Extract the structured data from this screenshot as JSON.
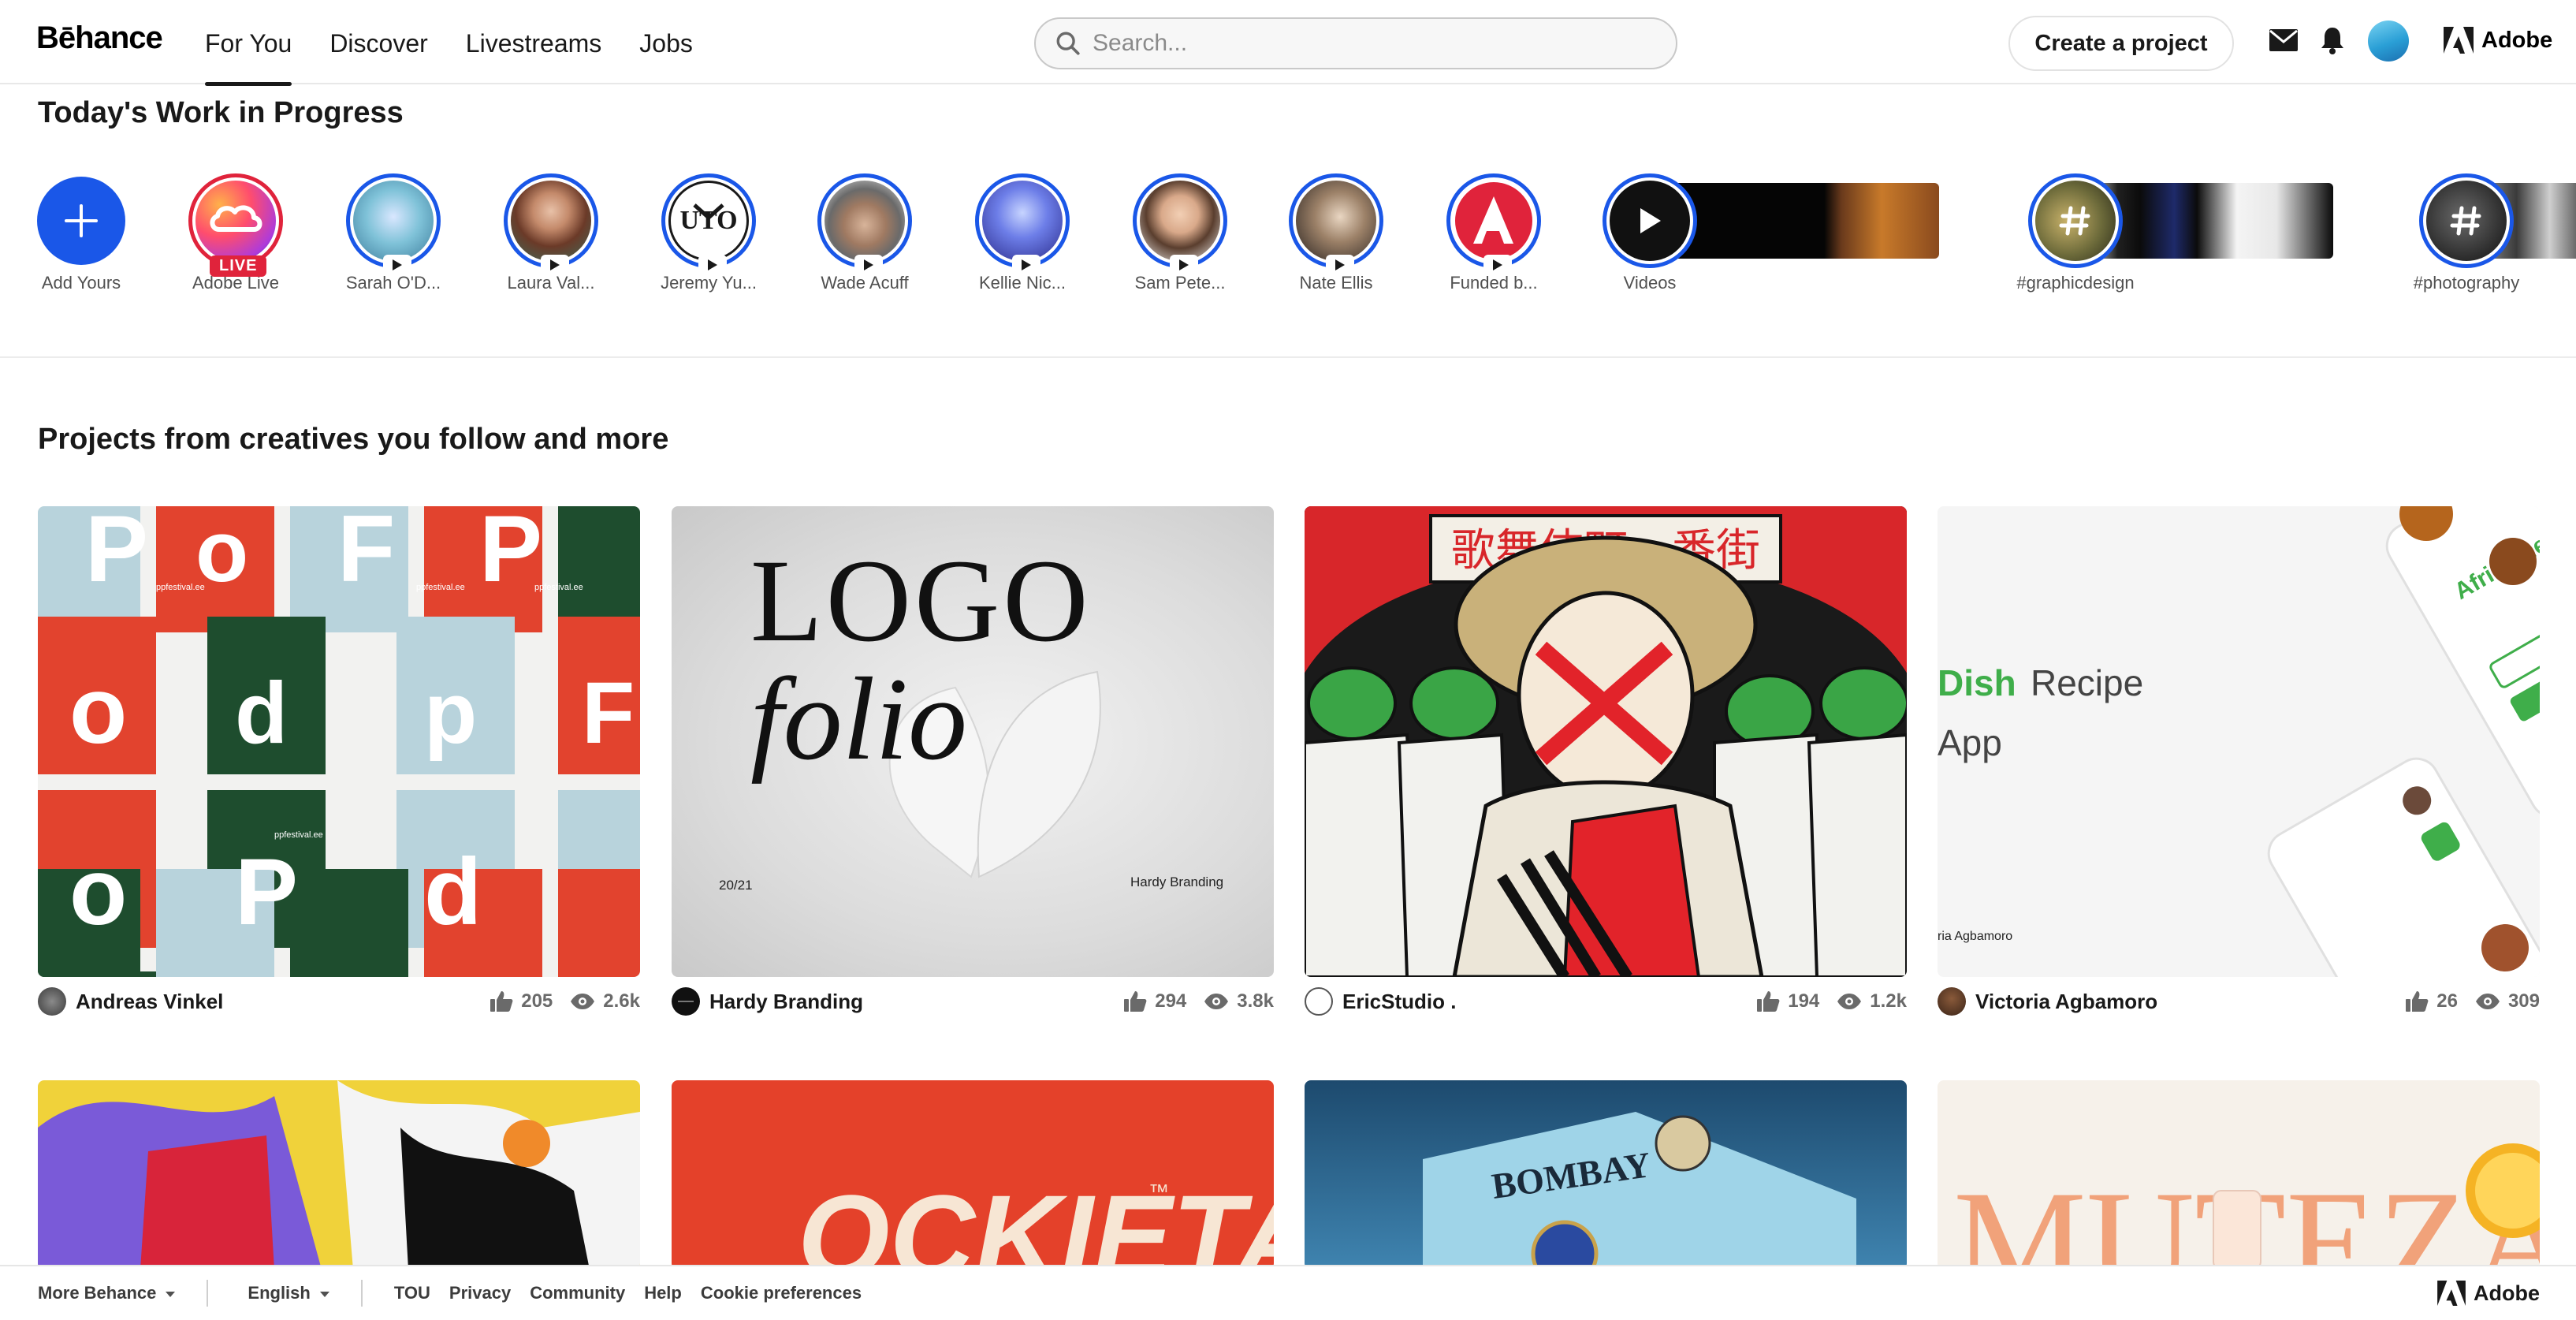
{
  "header": {
    "logo": "Bēhance",
    "nav": [
      "For You",
      "Discover",
      "Livestreams",
      "Jobs"
    ],
    "search_placeholder": "Search...",
    "create_label": "Create a project",
    "adobe_label": "Adobe"
  },
  "wip": {
    "title": "Today's Work in Progress",
    "add_label": "Add Yours",
    "live_badge": "LIVE",
    "stories": [
      "Adobe Live",
      "Sarah O'D...",
      "Laura Val...",
      "Jeremy Yu...",
      "Wade Acuff",
      "Kellie Nic...",
      "Sam Pete...",
      "Nate Ellis",
      "Funded b..."
    ],
    "videos_label": "Videos",
    "tags": [
      "#graphicdesign",
      "#photography"
    ]
  },
  "projects": {
    "title": "Projects from creatives you follow and more",
    "cards": [
      {
        "owner": "Andreas Vinkel",
        "likes": "205",
        "views": "2.6k",
        "thumb_text": "ppfestival.ee"
      },
      {
        "owner": "Hardy Branding",
        "likes": "294",
        "views": "3.8k",
        "thumb_line1": "LOGO",
        "thumb_line2": "folio",
        "thumb_year": "20/21",
        "thumb_caption": "Hardy Branding"
      },
      {
        "owner": "EricStudio .",
        "likes": "194",
        "views": "1.2k",
        "thumb_sign": "歌舞伎町一番街"
      },
      {
        "owner": "Victoria Agbamoro",
        "likes": "26",
        "views": "309",
        "thumb_accent": "Dish",
        "thumb_word": "Recipe",
        "thumb_word2": "App",
        "thumb_credit": "ria Agbamoro",
        "thumb_app": "Afridishes"
      }
    ],
    "row2": [
      {
        "thumb_text": ""
      },
      {
        "thumb_text": "OCKIETA"
      },
      {
        "thumb_text": "BOMBAY"
      },
      {
        "thumb_text": "MUTEZA"
      }
    ]
  },
  "footer": {
    "more": "More Behance",
    "language": "English",
    "links": [
      "TOU",
      "Privacy",
      "Community",
      "Help",
      "Cookie preferences"
    ],
    "adobe_label": "Adobe"
  },
  "colors": {
    "accent": "#1a57e8",
    "live": "#e0233b"
  }
}
